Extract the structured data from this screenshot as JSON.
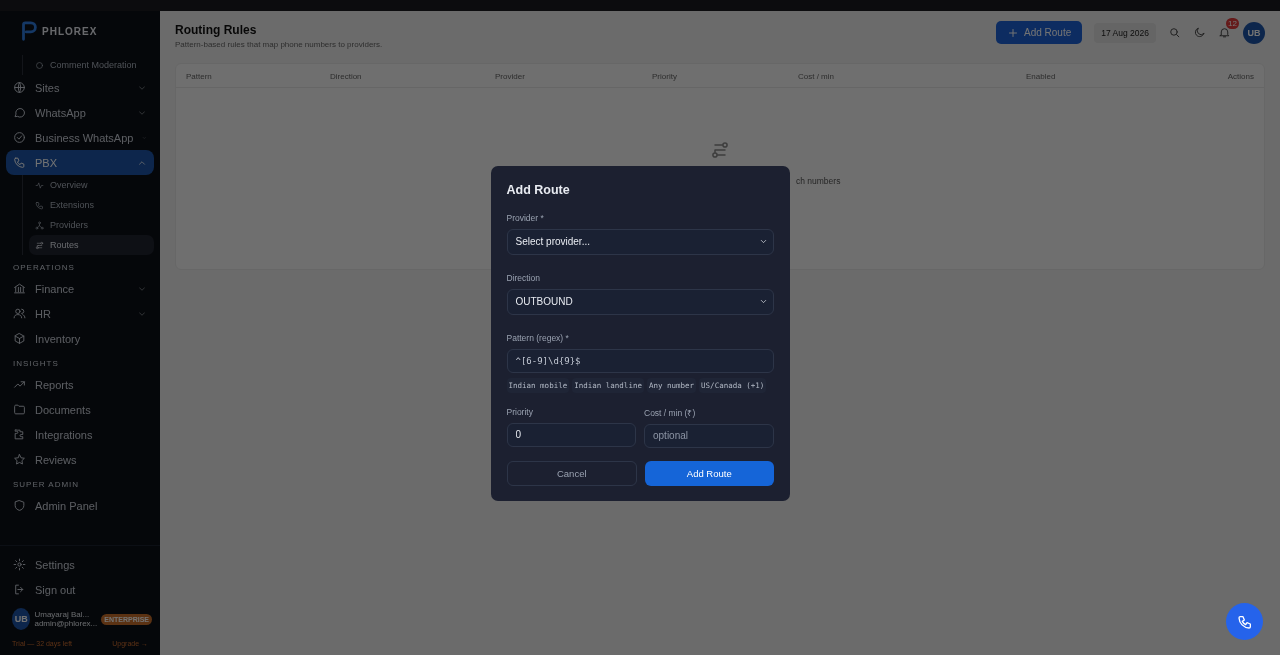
{
  "sidebar": {
    "logo": "PHLOREX",
    "sub_items_top": [
      {
        "label": "Comment Moderation"
      }
    ],
    "groups": [
      {
        "items": [
          {
            "label": "Sites",
            "expanded": false,
            "selected": false
          },
          {
            "label": "WhatsApp",
            "expanded": false,
            "selected": false
          },
          {
            "label": "Business WhatsApp",
            "expanded": false,
            "selected": false
          },
          {
            "label": "PBX",
            "expanded": true,
            "selected": true,
            "children": [
              {
                "label": "Overview",
                "selected": false
              },
              {
                "label": "Extensions",
                "selected": false
              },
              {
                "label": "Providers",
                "selected": false
              },
              {
                "label": "Routes",
                "selected": true
              }
            ]
          }
        ]
      },
      {
        "heading": "OPERATIONS",
        "items": [
          {
            "label": "Finance",
            "expanded": false,
            "selected": false
          },
          {
            "label": "HR",
            "expanded": false,
            "selected": false
          },
          {
            "label": "Inventory",
            "selected": false
          }
        ]
      },
      {
        "heading": "INSIGHTS",
        "items": [
          {
            "label": "Reports",
            "selected": false
          },
          {
            "label": "Documents",
            "selected": false
          },
          {
            "label": "Integrations",
            "selected": false
          },
          {
            "label": "Reviews",
            "selected": false
          }
        ]
      },
      {
        "heading": "SUPER ADMIN",
        "items": [
          {
            "label": "Admin Panel",
            "selected": false
          }
        ]
      }
    ],
    "bottom": [
      {
        "label": "Settings"
      },
      {
        "label": "Sign out"
      }
    ],
    "user": {
      "initials": "UB",
      "name": "Umayaraj Bal...",
      "email": "admin@phlorex...",
      "badge": "ENTERPRISE"
    },
    "trial": {
      "text": "Trial — 32 days left",
      "link": "Upgrade →"
    }
  },
  "header": {
    "title": "Routing Rules",
    "subtitle": "Pattern-based rules that map phone numbers to providers.",
    "add_button": "Add Route",
    "date": "17 Aug 2026",
    "notifications": "12",
    "avatar": "UB"
  },
  "table": {
    "columns": [
      "Pattern",
      "Direction",
      "Provider",
      "Priority",
      "Cost / min",
      "Enabled",
      "Actions"
    ],
    "empty_text": "ch numbers"
  },
  "modal": {
    "title": "Add Route",
    "provider": {
      "label": "Provider *",
      "value": "Select provider..."
    },
    "direction": {
      "label": "Direction",
      "value": "OUTBOUND"
    },
    "pattern": {
      "label": "Pattern (regex) *",
      "value": "^[6-9]\\d{9}$",
      "presets": [
        "Indian mobile",
        "Indian landline",
        "Any number",
        "US/Canada (+1)"
      ]
    },
    "priority": {
      "label": "Priority",
      "value": "0"
    },
    "cost": {
      "label": "Cost / min (₹)",
      "placeholder": "optional"
    },
    "cancel": "Cancel",
    "submit": "Add Route"
  }
}
